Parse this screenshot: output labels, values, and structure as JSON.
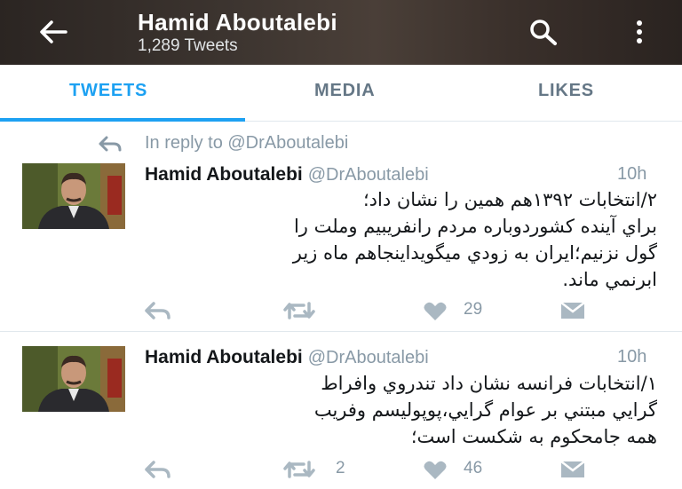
{
  "header": {
    "title": "Hamid Aboutalebi",
    "subtitle": "1,289 Tweets",
    "back_icon": "arrow-left-icon",
    "search_icon": "search-icon",
    "more_icon": "more-vertical-icon"
  },
  "tabs": [
    {
      "label": "TWEETS",
      "active": true
    },
    {
      "label": "MEDIA",
      "active": false
    },
    {
      "label": "LIKES",
      "active": false
    }
  ],
  "colors": {
    "accent": "#1da1f2",
    "muted": "#8899a6",
    "text": "#14171a"
  },
  "tweets": [
    {
      "reply_to": "In reply to @DrAboutalebi",
      "name": "Hamid Aboutalebi",
      "handle": "@DrAboutalebi",
      "time": "10h",
      "lines": [
        "٢/انتخابات ١٣٩٢هم همين را نشان داد؛",
        "براي آينده كشوردوباره مردم رانفريبيم وملت را",
        "گول نزنيم؛ايران به زودي ميگويداينجاهم ماه زير",
        "ابرنمي ماند."
      ],
      "retweets": "",
      "likes": "29"
    },
    {
      "reply_to": "",
      "name": "Hamid Aboutalebi",
      "handle": "@DrAboutalebi",
      "time": "10h",
      "lines": [
        "١/انتخابات فرانسه نشان داد تندروي وافراط",
        "گرايي مبتني بر عوام گرايي،پوپوليسم وفريب",
        "همه جامحكوم به شكست است؛"
      ],
      "retweets": "2",
      "likes": "46"
    }
  ]
}
